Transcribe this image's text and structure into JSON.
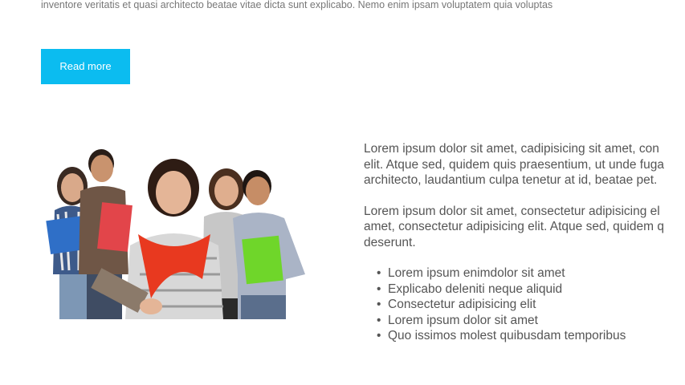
{
  "intro": {
    "text": "inventore veritatis et quasi architecto beatae vitae dicta sunt explicabo. Nemo enim ipsam voluptatem quia voluptas"
  },
  "read_more_button": {
    "label": "Read more",
    "color": "#0bbcf0"
  },
  "photo": {
    "subject": "group-of-five-students-holding-books"
  },
  "content": {
    "paragraph_1": [
      "Lorem ipsum dolor sit amet, cadipisicing sit amet, con",
      "elit. Atque sed, quidem quis praesentium, ut unde fuga",
      "architecto, laudantium culpa tenetur at id, beatae pet."
    ],
    "paragraph_2": [
      "Lorem ipsum dolor sit amet, consectetur adipisicing el",
      "amet, consectetur adipisicing elit. Atque sed, quidem q",
      "deserunt."
    ],
    "bullets": [
      "Lorem ipsum enimdolor sit amet",
      "Explicabo deleniti neque aliquid",
      "Consectetur adipisicing elit",
      "Lorem ipsum dolor sit amet",
      "Quo issimos molest quibusdam temporibus"
    ]
  }
}
